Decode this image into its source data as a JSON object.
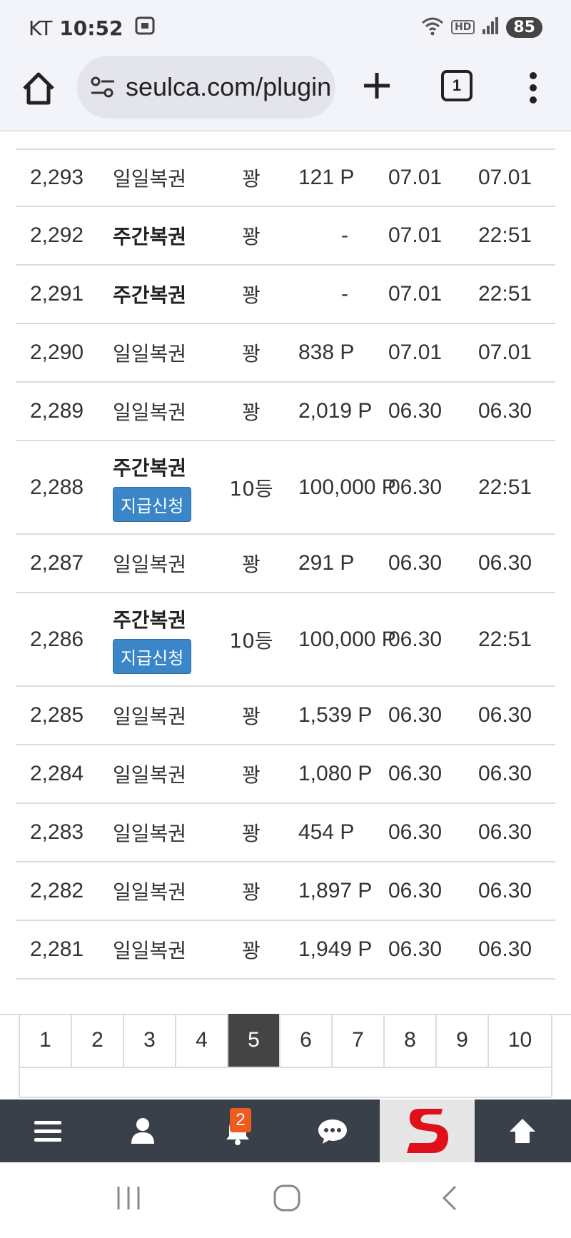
{
  "status_bar": {
    "carrier": "KT",
    "time": "10:52",
    "hd_label": "HD",
    "battery": "85"
  },
  "browser": {
    "url": "seulca.com/plugin",
    "tab_count": "1"
  },
  "rows": [
    {
      "num": "2,293",
      "type": "일일복권",
      "bold": false,
      "rank": "꽝",
      "points": "121 P",
      "date1": "07.01",
      "date2": "07.01"
    },
    {
      "num": "2,292",
      "type": "주간복권",
      "bold": true,
      "rank": "꽝",
      "points": "-",
      "date1": "07.01",
      "date2": "22:51"
    },
    {
      "num": "2,291",
      "type": "주간복권",
      "bold": true,
      "rank": "꽝",
      "points": "-",
      "date1": "07.01",
      "date2": "22:51"
    },
    {
      "num": "2,290",
      "type": "일일복권",
      "bold": false,
      "rank": "꽝",
      "points": "838 P",
      "date1": "07.01",
      "date2": "07.01"
    },
    {
      "num": "2,289",
      "type": "일일복권",
      "bold": false,
      "rank": "꽝",
      "points": "2,019 P",
      "date1": "06.30",
      "date2": "06.30"
    },
    {
      "num": "2,288",
      "type": "주간복권",
      "bold": true,
      "claim": "지급신청",
      "rank": "10등",
      "points": "100,000 P",
      "date1": "06.30",
      "date2": "22:51"
    },
    {
      "num": "2,287",
      "type": "일일복권",
      "bold": false,
      "rank": "꽝",
      "points": "291 P",
      "date1": "06.30",
      "date2": "06.30"
    },
    {
      "num": "2,286",
      "type": "주간복권",
      "bold": true,
      "claim": "지급신청",
      "rank": "10등",
      "points": "100,000 P",
      "date1": "06.30",
      "date2": "22:51"
    },
    {
      "num": "2,285",
      "type": "일일복권",
      "bold": false,
      "rank": "꽝",
      "points": "1,539 P",
      "date1": "06.30",
      "date2": "06.30"
    },
    {
      "num": "2,284",
      "type": "일일복권",
      "bold": false,
      "rank": "꽝",
      "points": "1,080 P",
      "date1": "06.30",
      "date2": "06.30"
    },
    {
      "num": "2,283",
      "type": "일일복권",
      "bold": false,
      "rank": "꽝",
      "points": "454 P",
      "date1": "06.30",
      "date2": "06.30"
    },
    {
      "num": "2,282",
      "type": "일일복권",
      "bold": false,
      "rank": "꽝",
      "points": "1,897 P",
      "date1": "06.30",
      "date2": "06.30"
    },
    {
      "num": "2,281",
      "type": "일일복권",
      "bold": false,
      "rank": "꽝",
      "points": "1,949 P",
      "date1": "06.30",
      "date2": "06.30"
    }
  ],
  "pagination": {
    "pages": [
      "1",
      "2",
      "3",
      "4",
      "5",
      "6",
      "7",
      "8",
      "9",
      "10"
    ],
    "current": "5"
  },
  "bottom_nav": {
    "notification_count": "2",
    "logo_letter": "S",
    "items": [
      "menu-icon",
      "user-icon",
      "bell-icon",
      "chat-icon",
      "site-logo",
      "arrow-up-icon"
    ]
  },
  "colors": {
    "claim_button": "#3a86c8",
    "nav_bg": "#39404a",
    "active_page": "#444444",
    "badge": "#ef5a1e",
    "logo_red": "#e0101a"
  }
}
